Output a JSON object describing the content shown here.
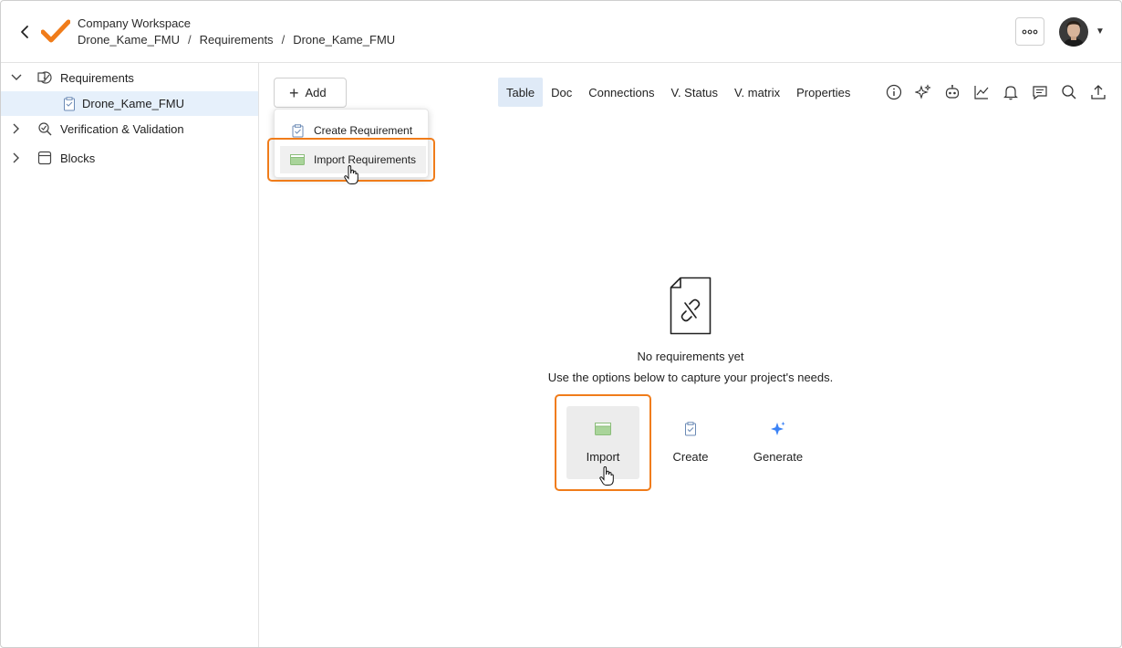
{
  "header": {
    "workspace": "Company Workspace",
    "breadcrumb": [
      "Drone_Kame_FMU",
      "Requirements",
      "Drone_Kame_FMU"
    ],
    "separator": "/",
    "brand_color": "#f07c1a"
  },
  "sidebar": {
    "items": [
      {
        "label": "Requirements",
        "expanded": true,
        "icon": "requirements-icon"
      },
      {
        "label": "Drone_Kame_FMU",
        "selected": true,
        "icon": "document-icon"
      },
      {
        "label": "Verification & Validation",
        "expanded": false,
        "icon": "verification-icon"
      },
      {
        "label": "Blocks",
        "expanded": false,
        "icon": "block-icon"
      }
    ]
  },
  "main": {
    "add_label": "Add",
    "tabs": [
      "Table",
      "Doc",
      "Connections",
      "V. Status",
      "V. matrix",
      "Properties"
    ],
    "active_tab": "Table",
    "toolbar_icons": [
      "info-icon",
      "sparkle-icon",
      "robot-icon",
      "chart-icon",
      "bell-icon",
      "comment-icon",
      "search-icon",
      "upload-icon"
    ]
  },
  "dropdown": {
    "items": [
      "Create Requirement",
      "Import Requirements"
    ],
    "highlighted": "Import Requirements"
  },
  "empty_state": {
    "title": "No requirements yet",
    "subtitle": "Use the options below to capture your project's needs.",
    "options": [
      "Import",
      "Create",
      "Generate"
    ],
    "highlighted": "Import"
  },
  "colors": {
    "highlight": "#f07c1a",
    "tab_active": "#dfeaf7",
    "selected_row": "#e6f0fb",
    "accent_blue": "#3b82f6"
  }
}
